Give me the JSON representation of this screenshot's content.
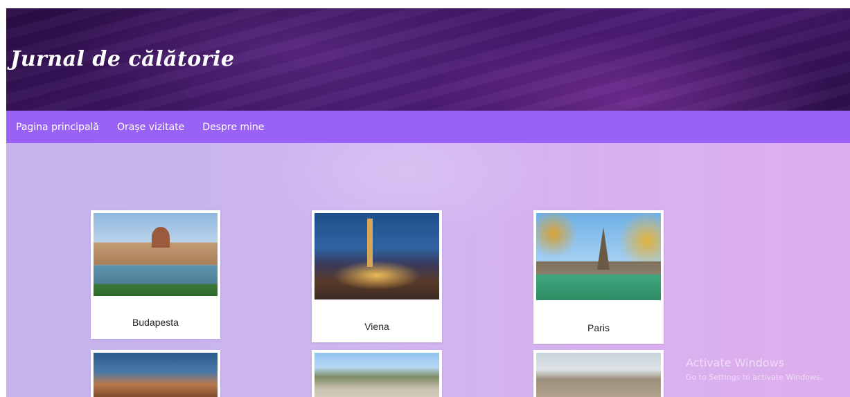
{
  "header": {
    "title": "Jurnal de călătorie"
  },
  "nav": {
    "items": [
      "Pagina principală",
      "Orașe vizitate",
      "Despre mine"
    ]
  },
  "cards": [
    {
      "city": "Budapesta"
    },
    {
      "city": "Viena"
    },
    {
      "city": "Paris"
    }
  ],
  "watermark": {
    "title": "Activate Windows",
    "subtitle": "Go to Settings to activate Windows."
  },
  "colors": {
    "nav_bg": "#9a62f4",
    "header_bg": "#3b1660",
    "content_bg": "#cfb5f0"
  }
}
